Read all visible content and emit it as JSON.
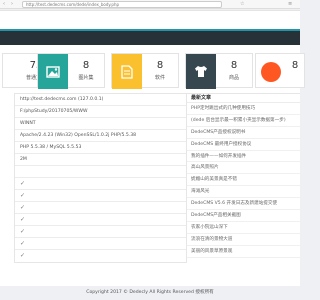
{
  "browser": {
    "back": "‹",
    "forward": "›",
    "address": "http://test.dedecms.com/dede/index_body.php",
    "star": "☆",
    "menu": "≡"
  },
  "stats": [
    {
      "value": "75",
      "label": "普通文章",
      "color": "#ffffff"
    },
    {
      "value": "8",
      "label": "图片集",
      "color": "#26a69a",
      "icon": "image-icon"
    },
    {
      "value": "8",
      "label": "软件",
      "color": "#fbc02d",
      "icon": "document-icon"
    },
    {
      "value": "8",
      "label": "商品",
      "color": "#37474f",
      "icon": "tshirt-icon"
    },
    {
      "value": "8",
      "label": "",
      "color": "#ff5722",
      "icon": "circle-icon"
    }
  ],
  "info_rows": [
    "http://test.dedecms.com (127.0.0.1)",
    "F:/phpStudy/20170705/WWW",
    "WINNT",
    "Apache/2.4.23 (Win32) OpenSSL/1.0.2j PHP/5.5.38",
    "PHP 5.5.38 / MySQL 5.5.53",
    "2M",
    "",
    "✓",
    "✓",
    "✓",
    "✓",
    "✓",
    "✓",
    "✓"
  ],
  "news": {
    "heading": "最新文章",
    "items": [
      "PHP定时跳出式的几种使用技巧",
      "(dede 后台显示最一积累小夹显示数据第一步)",
      "DedeCMS产品授权说明书",
      "DedeCMS 最终用户授权协议",
      "我的插件——如何开发插件",
      "高山风景照片",
      "妩媚山的美景真是不错",
      "海滩风光",
      "DedeCMS V5.6 开发日志及新建站提交使",
      "DedeCMS产品相关截图",
      "农家小院远山深下",
      "流浪在清的景物大道",
      "美丽的风景草原景观"
    ]
  },
  "footer": "Copyright 2017 © Dedecly  All Rights Reserved  授权所有"
}
